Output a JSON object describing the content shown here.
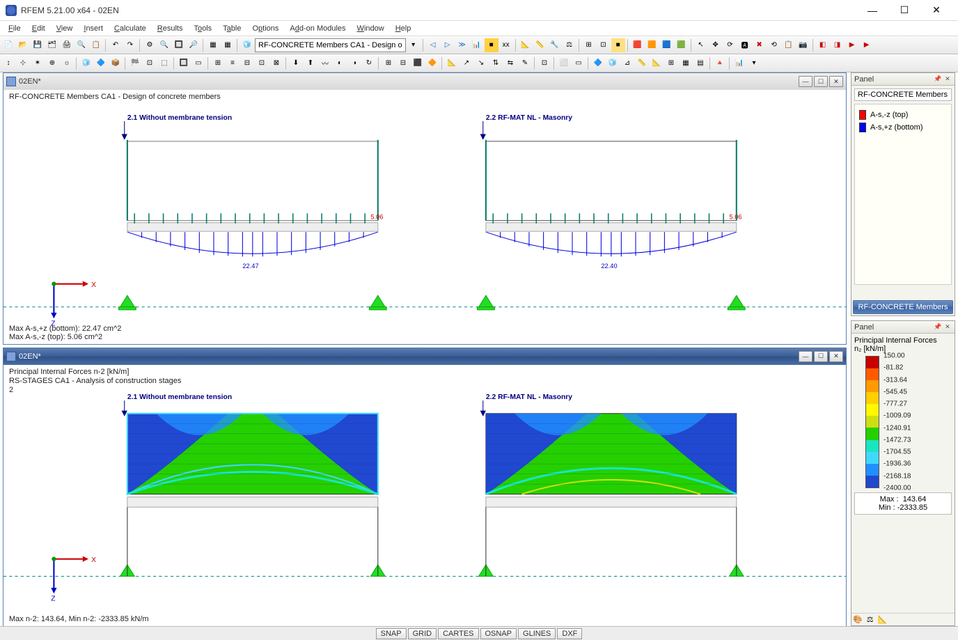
{
  "app": {
    "title": "RFEM 5.21.00 x64 - 02EN"
  },
  "winbtns": {
    "min": "—",
    "max": "☐",
    "close": "✕"
  },
  "menu": [
    "File",
    "Edit",
    "View",
    "Insert",
    "Calculate",
    "Results",
    "Tools",
    "Table",
    "Options",
    "Add-on Modules",
    "Window",
    "Help"
  ],
  "combo": "RF-CONCRETE Members CA1 - Design o",
  "doc1": {
    "title": "02EN*",
    "label": "RF-CONCRETE Members CA1 - Design of concrete members",
    "case_left": "2.1 Without membrane tension",
    "case_right": "2.2 RF-MAT NL - Masonry",
    "val_top": "5.06",
    "val_left_bottom": "22.47",
    "val_right_bottom": "22.40",
    "summary1": "Max A-s,+z (bottom): 22.47 cm^2",
    "summary2": "Max A-s,-z (top): 5.06 cm^2"
  },
  "doc2": {
    "title": "02EN*",
    "label1": "Principal Internal Forces n-2 [kN/m]",
    "label2": "RS-STAGES CA1 - Analysis of construction stages",
    "label3": "2",
    "case_left": "2.1 Without membrane tension",
    "case_right": "2.2 RF-MAT NL - Masonry",
    "summary": "Max n-2: 143.64, Min n-2: -2333.85 kN/m"
  },
  "panel1": {
    "title": "Panel",
    "heading": "RF-CONCRETE Members",
    "legend": [
      {
        "color": "#ff0000",
        "label": "A-s,-z (top)"
      },
      {
        "color": "#0000ff",
        "label": "A-s,+z (bottom)"
      }
    ],
    "tab": "RF-CONCRETE Members"
  },
  "panel2": {
    "title": "Panel",
    "heading1": "Principal Internal Forces",
    "heading2": "n₂ [kN/m]",
    "scale": [
      "150.00",
      "-81.82",
      "-313.64",
      "-545.45",
      "-777.27",
      "-1009.09",
      "-1240.91",
      "-1472.73",
      "-1704.55",
      "-1936.36",
      "-2168.18",
      "-2400.00"
    ],
    "colors": [
      "#c80000",
      "#ff5a00",
      "#ff9a00",
      "#ffcf00",
      "#fff800",
      "#cddf10",
      "#24d000",
      "#18e6c0",
      "#40d8ff",
      "#2090ff",
      "#2048d0",
      "#101090"
    ],
    "max_label": "Max  :",
    "max": "143.64",
    "min_label": "Min   :",
    "min": "-2333.85"
  },
  "status": [
    "SNAP",
    "GRID",
    "CARTES",
    "OSNAP",
    "GLINES",
    "DXF"
  ],
  "chart_data": [
    {
      "type": "line",
      "title": "Reinforcement A-s,+z (bottom) — Case 2.1",
      "x_range_m": [
        0,
        10
      ],
      "unit": "cm^2",
      "max_value": 22.47,
      "top_max": 5.06,
      "profile": "parabolic, peak at midspan"
    },
    {
      "type": "line",
      "title": "Reinforcement A-s,+z (bottom) — Case 2.2",
      "x_range_m": [
        0,
        10
      ],
      "unit": "cm^2",
      "max_value": 22.4,
      "top_max": 5.06,
      "profile": "parabolic, peak at midspan"
    },
    {
      "type": "heatmap",
      "title": "Principal Internal Forces n-2 — Case 2.1",
      "unit": "kN/m",
      "range": [
        -2400,
        150
      ],
      "max": 143.64,
      "min": -2333.85
    },
    {
      "type": "heatmap",
      "title": "Principal Internal Forces n-2 — Case 2.2",
      "unit": "kN/m",
      "range": [
        -2400,
        150
      ],
      "max": 143.64,
      "min": -2333.85
    }
  ]
}
